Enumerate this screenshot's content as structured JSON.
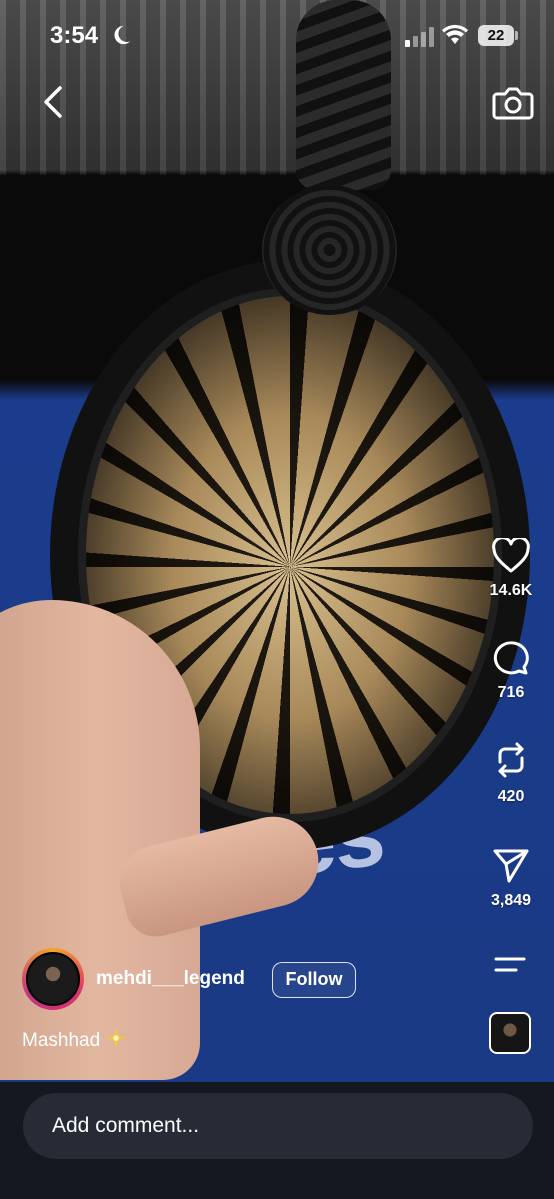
{
  "status_bar": {
    "time": "3:54",
    "battery": "22",
    "icons": [
      "moon-icon",
      "signal-icon",
      "wifi-icon",
      "battery-icon"
    ]
  },
  "top_bar": {
    "back_icon": "chevron-left-icon",
    "camera_icon": "camera-icon"
  },
  "actions": {
    "likes": "14.6K",
    "comments": "716",
    "reposts": "420",
    "shares": "3,849"
  },
  "author": {
    "username": "mehdi___legend",
    "follow_label": "Follow"
  },
  "caption": {
    "text": "Mashhad"
  },
  "comment_bar": {
    "placeholder": "Add comment..."
  }
}
